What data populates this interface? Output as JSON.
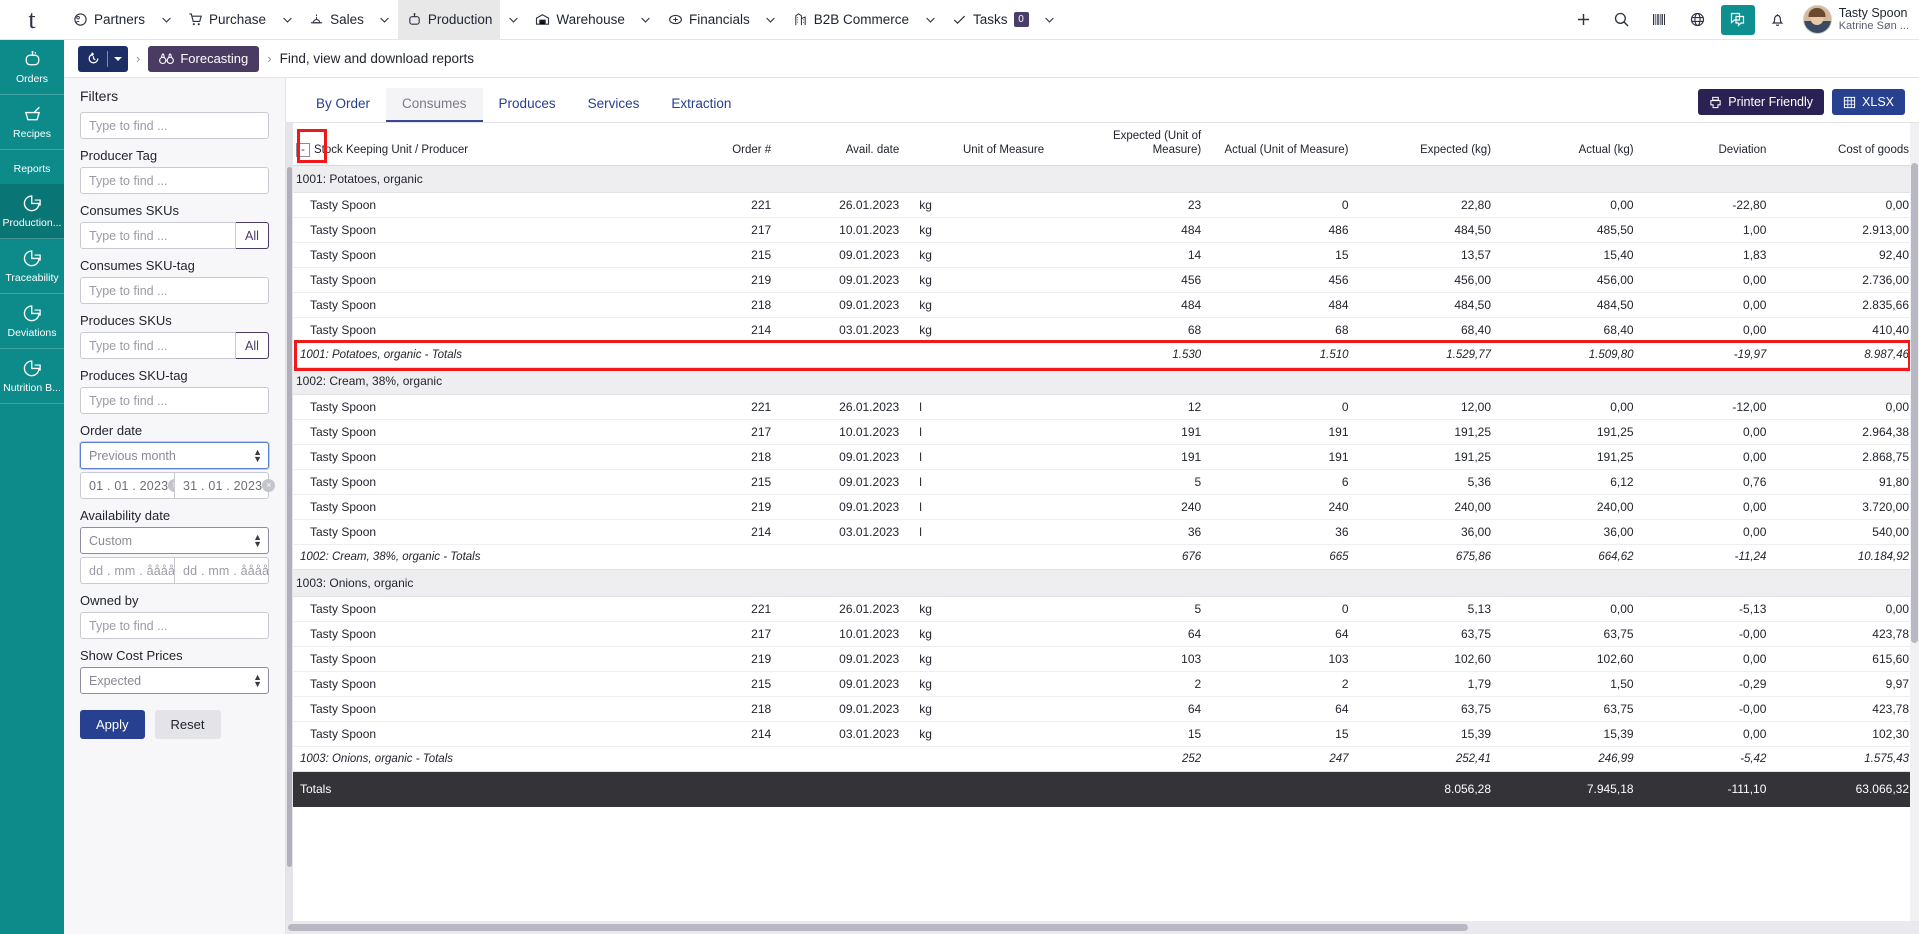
{
  "topbar": {
    "logo": "t",
    "nav": [
      {
        "label": "Partners",
        "icon": "partners-icon",
        "caret": true,
        "active": false
      },
      {
        "label": "Purchase",
        "icon": "cart-icon",
        "caret": true,
        "active": false
      },
      {
        "label": "Sales",
        "icon": "sales-icon",
        "caret": true,
        "active": false
      },
      {
        "label": "Production",
        "icon": "production-icon",
        "caret": true,
        "active": true
      },
      {
        "label": "Warehouse",
        "icon": "warehouse-icon",
        "caret": true,
        "active": false
      },
      {
        "label": "Financials",
        "icon": "financials-icon",
        "caret": true,
        "active": false
      },
      {
        "label": "B2B Commerce",
        "icon": "b2b-icon",
        "caret": true,
        "active": false
      },
      {
        "label": "Tasks",
        "icon": "check-icon",
        "caret": true,
        "active": false,
        "badge": "0"
      }
    ],
    "actions": [
      {
        "name": "add-button",
        "icon": "plus-icon"
      },
      {
        "name": "search-button",
        "icon": "search-icon"
      },
      {
        "name": "barcode-button",
        "icon": "barcode-icon"
      },
      {
        "name": "globe-button",
        "icon": "globe-icon"
      },
      {
        "name": "chat-button",
        "icon": "chat-icon"
      },
      {
        "name": "notifications-button",
        "icon": "bell-icon"
      }
    ],
    "user": {
      "company": "Tasty Spoon",
      "name": "Katrine Søn ..."
    }
  },
  "rail": {
    "items": [
      {
        "label": "Orders",
        "icon": "pot-icon",
        "selected": false,
        "is_header": false
      },
      {
        "label": "Recipes",
        "icon": "mortar-icon",
        "selected": false,
        "is_header": false
      },
      {
        "label": "Reports",
        "icon": "",
        "selected": false,
        "is_header": true
      },
      {
        "label": "Production...",
        "icon": "pie-chart-icon",
        "selected": true,
        "is_header": false
      },
      {
        "label": "Traceability",
        "icon": "pie-chart-icon",
        "selected": false,
        "is_header": false
      },
      {
        "label": "Deviations",
        "icon": "pie-chart-icon",
        "selected": false,
        "is_header": false
      },
      {
        "label": "Nutrition B...",
        "icon": "pie-chart-icon",
        "selected": false,
        "is_header": false
      }
    ]
  },
  "breadcrumb": {
    "history_icon": "history-icon",
    "forecasting": "Forecasting",
    "forecasting_icon": "binoculars-icon",
    "page": "Find, view and download reports"
  },
  "filters": {
    "title": "Filters",
    "producer_search_placeholder": "Type to find ...",
    "groups": [
      {
        "label": "Producer Tag",
        "placeholder": "Type to find ...",
        "all": false
      },
      {
        "label": "Consumes SKUs",
        "placeholder": "Type to find ...",
        "all": true,
        "all_label": "All"
      },
      {
        "label": "Consumes SKU-tag",
        "placeholder": "Type to find ...",
        "all": false
      },
      {
        "label": "Produces SKUs",
        "placeholder": "Type to find ...",
        "all": true,
        "all_label": "All"
      },
      {
        "label": "Produces SKU-tag",
        "placeholder": "Type to find ...",
        "all": false
      }
    ],
    "order_date": {
      "label": "Order date",
      "select_value": "Previous month",
      "from": "01 . 01 . 2023",
      "to": "31 . 01 . 2023",
      "clearable": true
    },
    "availability_date": {
      "label": "Availability date",
      "select_value": "Custom",
      "from_placeholder": "dd . mm . åååå",
      "to_placeholder": "dd . mm . åååå",
      "clearable": false
    },
    "owned_by": {
      "label": "Owned by",
      "placeholder": "Type to find ..."
    },
    "show_cost_prices": {
      "label": "Show Cost Prices",
      "value": "Expected"
    },
    "apply_label": "Apply",
    "reset_label": "Reset"
  },
  "report": {
    "tabs": [
      {
        "label": "By Order",
        "active": false
      },
      {
        "label": "Consumes",
        "active": true
      },
      {
        "label": "Produces",
        "active": false
      },
      {
        "label": "Services",
        "active": false
      },
      {
        "label": "Extraction",
        "active": false
      }
    ],
    "actions": [
      {
        "label": "Printer Friendly",
        "icon": "printer-icon",
        "style": "purple"
      },
      {
        "label": "XLSX",
        "icon": "spreadsheet-icon",
        "style": "blue"
      }
    ],
    "columns": [
      "Stock Keeping Unit / Producer",
      "Order #",
      "Avail. date",
      "Unit of Measure",
      "Expected (Unit of Measure)",
      "Actual (Unit of Measure)",
      "Expected (kg)",
      "Actual (kg)",
      "Deviation",
      "Cost of goods"
    ],
    "expander_collapse": "-",
    "groups": [
      {
        "title": "1001: Potatoes, organic",
        "highlighted_totals": true,
        "rows": [
          {
            "name": "Tasty Spoon",
            "order": "221",
            "date": "26.01.2023",
            "uom": "kg",
            "exp_uom": "23",
            "act_uom": "0",
            "exp_kg": "22,80",
            "act_kg": "0,00",
            "dev": "-22,80",
            "cost": "0,00"
          },
          {
            "name": "Tasty Spoon",
            "order": "217",
            "date": "10.01.2023",
            "uom": "kg",
            "exp_uom": "484",
            "act_uom": "486",
            "exp_kg": "484,50",
            "act_kg": "485,50",
            "dev": "1,00",
            "cost": "2.913,00"
          },
          {
            "name": "Tasty Spoon",
            "order": "215",
            "date": "09.01.2023",
            "uom": "kg",
            "exp_uom": "14",
            "act_uom": "15",
            "exp_kg": "13,57",
            "act_kg": "15,40",
            "dev": "1,83",
            "cost": "92,40"
          },
          {
            "name": "Tasty Spoon",
            "order": "219",
            "date": "09.01.2023",
            "uom": "kg",
            "exp_uom": "456",
            "act_uom": "456",
            "exp_kg": "456,00",
            "act_kg": "456,00",
            "dev": "0,00",
            "cost": "2.736,00"
          },
          {
            "name": "Tasty Spoon",
            "order": "218",
            "date": "09.01.2023",
            "uom": "kg",
            "exp_uom": "484",
            "act_uom": "484",
            "exp_kg": "484,50",
            "act_kg": "484,50",
            "dev": "0,00",
            "cost": "2.835,66"
          },
          {
            "name": "Tasty Spoon",
            "order": "214",
            "date": "03.01.2023",
            "uom": "kg",
            "exp_uom": "68",
            "act_uom": "68",
            "exp_kg": "68,40",
            "act_kg": "68,40",
            "dev": "0,00",
            "cost": "410,40"
          }
        ],
        "totals": {
          "name": "1001: Potatoes, organic - Totals",
          "exp_uom": "1.530",
          "act_uom": "1.510",
          "exp_kg": "1.529,77",
          "act_kg": "1.509,80",
          "dev": "-19,97",
          "cost": "8.987,46"
        }
      },
      {
        "title": "1002: Cream, 38%, organic",
        "highlighted_totals": false,
        "rows": [
          {
            "name": "Tasty Spoon",
            "order": "221",
            "date": "26.01.2023",
            "uom": "l",
            "exp_uom": "12",
            "act_uom": "0",
            "exp_kg": "12,00",
            "act_kg": "0,00",
            "dev": "-12,00",
            "cost": "0,00"
          },
          {
            "name": "Tasty Spoon",
            "order": "217",
            "date": "10.01.2023",
            "uom": "l",
            "exp_uom": "191",
            "act_uom": "191",
            "exp_kg": "191,25",
            "act_kg": "191,25",
            "dev": "0,00",
            "cost": "2.964,38"
          },
          {
            "name": "Tasty Spoon",
            "order": "218",
            "date": "09.01.2023",
            "uom": "l",
            "exp_uom": "191",
            "act_uom": "191",
            "exp_kg": "191,25",
            "act_kg": "191,25",
            "dev": "0,00",
            "cost": "2.868,75"
          },
          {
            "name": "Tasty Spoon",
            "order": "215",
            "date": "09.01.2023",
            "uom": "l",
            "exp_uom": "5",
            "act_uom": "6",
            "exp_kg": "5,36",
            "act_kg": "6,12",
            "dev": "0,76",
            "cost": "91,80"
          },
          {
            "name": "Tasty Spoon",
            "order": "219",
            "date": "09.01.2023",
            "uom": "l",
            "exp_uom": "240",
            "act_uom": "240",
            "exp_kg": "240,00",
            "act_kg": "240,00",
            "dev": "0,00",
            "cost": "3.720,00"
          },
          {
            "name": "Tasty Spoon",
            "order": "214",
            "date": "03.01.2023",
            "uom": "l",
            "exp_uom": "36",
            "act_uom": "36",
            "exp_kg": "36,00",
            "act_kg": "36,00",
            "dev": "0,00",
            "cost": "540,00"
          }
        ],
        "totals": {
          "name": "1002: Cream, 38%, organic - Totals",
          "exp_uom": "676",
          "act_uom": "665",
          "exp_kg": "675,86",
          "act_kg": "664,62",
          "dev": "-11,24",
          "cost": "10.184,92"
        }
      },
      {
        "title": "1003: Onions, organic",
        "highlighted_totals": false,
        "rows": [
          {
            "name": "Tasty Spoon",
            "order": "221",
            "date": "26.01.2023",
            "uom": "kg",
            "exp_uom": "5",
            "act_uom": "0",
            "exp_kg": "5,13",
            "act_kg": "0,00",
            "dev": "-5,13",
            "cost": "0,00"
          },
          {
            "name": "Tasty Spoon",
            "order": "217",
            "date": "10.01.2023",
            "uom": "kg",
            "exp_uom": "64",
            "act_uom": "64",
            "exp_kg": "63,75",
            "act_kg": "63,75",
            "dev": "-0,00",
            "cost": "423,78"
          },
          {
            "name": "Tasty Spoon",
            "order": "219",
            "date": "09.01.2023",
            "uom": "kg",
            "exp_uom": "103",
            "act_uom": "103",
            "exp_kg": "102,60",
            "act_kg": "102,60",
            "dev": "0,00",
            "cost": "615,60"
          },
          {
            "name": "Tasty Spoon",
            "order": "215",
            "date": "09.01.2023",
            "uom": "kg",
            "exp_uom": "2",
            "act_uom": "2",
            "exp_kg": "1,79",
            "act_kg": "1,50",
            "dev": "-0,29",
            "cost": "9,97"
          },
          {
            "name": "Tasty Spoon",
            "order": "218",
            "date": "09.01.2023",
            "uom": "kg",
            "exp_uom": "64",
            "act_uom": "64",
            "exp_kg": "63,75",
            "act_kg": "63,75",
            "dev": "-0,00",
            "cost": "423,78"
          },
          {
            "name": "Tasty Spoon",
            "order": "214",
            "date": "03.01.2023",
            "uom": "kg",
            "exp_uom": "15",
            "act_uom": "15",
            "exp_kg": "15,39",
            "act_kg": "15,39",
            "dev": "0,00",
            "cost": "102,30"
          }
        ],
        "totals": {
          "name": "1003: Onions, organic - Totals",
          "exp_uom": "252",
          "act_uom": "247",
          "exp_kg": "252,41",
          "act_kg": "246,99",
          "dev": "-5,42",
          "cost": "1.575,43"
        }
      }
    ],
    "grand_totals": {
      "name": "Totals",
      "exp_kg": "8.056,28",
      "act_kg": "7.945,18",
      "dev": "-111,10",
      "cost": "63.066,32"
    }
  }
}
